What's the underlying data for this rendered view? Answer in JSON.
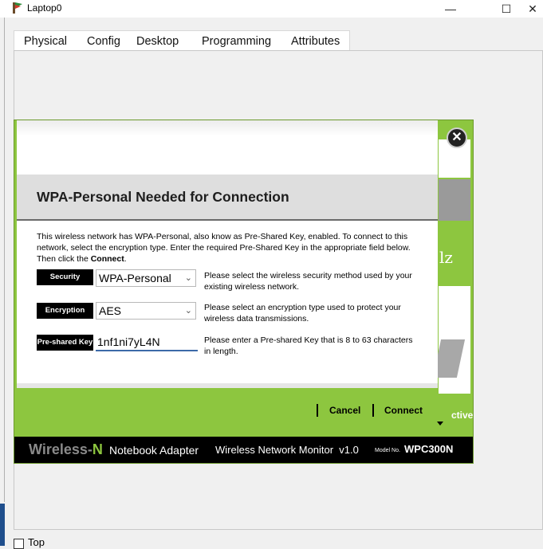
{
  "window": {
    "title": "Laptop0",
    "controls": {
      "minimize": "—",
      "maximize": "☐",
      "close": "✕"
    }
  },
  "tabs": [
    {
      "label": "Physical"
    },
    {
      "label": "Config"
    },
    {
      "label": "Desktop",
      "active": true
    },
    {
      "label": "Programming"
    },
    {
      "label": "Attributes"
    }
  ],
  "monitor": {
    "close_glyph": "✕",
    "right_partial_text": "lz",
    "right_partial_active": "ctive",
    "footer": {
      "brand_main": "Wireless-",
      "brand_n": "N",
      "adapter": "Notebook Adapter",
      "monitor_name": "Wireless Network Monitor  v1.0",
      "model_prefix": "Model No.",
      "model": "WPC300N"
    }
  },
  "dialog": {
    "title": "WPA-Personal Needed for Connection",
    "intro_line1": "This wireless network has WPA-Personal, also know as Pre-Shared Key, enabled. To connect to this",
    "intro_line2": "network, select the encryption type. Enter the required Pre-Shared Key in the appropriate field below.",
    "intro_line3_prefix": "Then click the ",
    "intro_line3_bold": "Connect",
    "intro_line3_suffix": ".",
    "security": {
      "label": "Security",
      "value": "WPA-Personal",
      "desc_line1": "Please select the wireless security method used by your",
      "desc_line2": "existing wireless network."
    },
    "encryption": {
      "label": "Encryption",
      "value": "AES",
      "desc_line1": "Please select an encryption type used to protect your",
      "desc_line2": "wireless data transmissions."
    },
    "preshared": {
      "label": "Pre-shared Key",
      "value": "1nf1ni7yL4N",
      "desc_line1": "Please enter a Pre-shared Key that is 8 to 63 characters",
      "desc_line2": "in length."
    },
    "buttons": {
      "cancel": "Cancel",
      "connect": "Connect"
    }
  },
  "bottom": {
    "checkbox_label": "Top"
  },
  "colors": {
    "accent_green": "#8dc63f",
    "tab_underline": "#1f3a6b",
    "input_underline": "#3c6aa8"
  }
}
